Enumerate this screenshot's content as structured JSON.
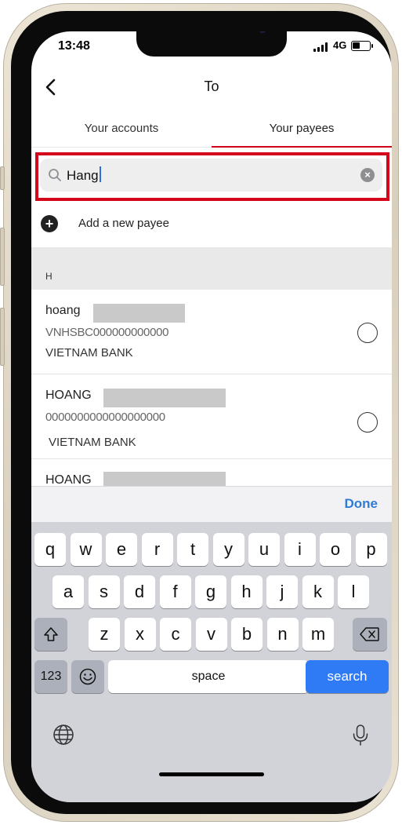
{
  "status_bar": {
    "time": "13:48",
    "network": "4G",
    "battery_level": 0.45
  },
  "nav": {
    "back_icon": "chevron-left-icon",
    "title": "To"
  },
  "tabs": [
    {
      "label": "Your accounts",
      "active": false
    },
    {
      "label": "Your payees",
      "active": true
    }
  ],
  "search": {
    "value": "Hang",
    "icon": "search-icon",
    "clear_icon": "clear-icon"
  },
  "add_payee": {
    "label": "Add a new payee",
    "icon": "plus-circle-icon"
  },
  "section": {
    "label": "H"
  },
  "payees": [
    {
      "name": "hoang",
      "account": "VNHSBC000000000000",
      "bank": "VIETNAM BANK"
    },
    {
      "name": "HOANG",
      "account": "0000000000000000000",
      "bank": "VIETNAM BANK"
    },
    {
      "name": "HOANG"
    }
  ],
  "toolbar": {
    "done_label": "Done"
  },
  "keyboard": {
    "row1": [
      "q",
      "w",
      "e",
      "r",
      "t",
      "y",
      "u",
      "i",
      "o",
      "p"
    ],
    "row2": [
      "a",
      "s",
      "d",
      "f",
      "g",
      "h",
      "j",
      "k",
      "l"
    ],
    "row3": [
      "z",
      "x",
      "c",
      "v",
      "b",
      "n",
      "m"
    ],
    "numbers_label": "123",
    "space_label": "space",
    "search_label": "search",
    "shift_icon": "shift-icon",
    "backspace_icon": "backspace-icon",
    "emoji_icon": "emoji-icon",
    "globe_icon": "globe-icon",
    "mic_icon": "microphone-icon"
  },
  "colors": {
    "accent_red": "#d0021b",
    "highlight_red": "#d4061c",
    "ios_blue": "#2f7bf6",
    "done_blue": "#2f7bd6"
  }
}
